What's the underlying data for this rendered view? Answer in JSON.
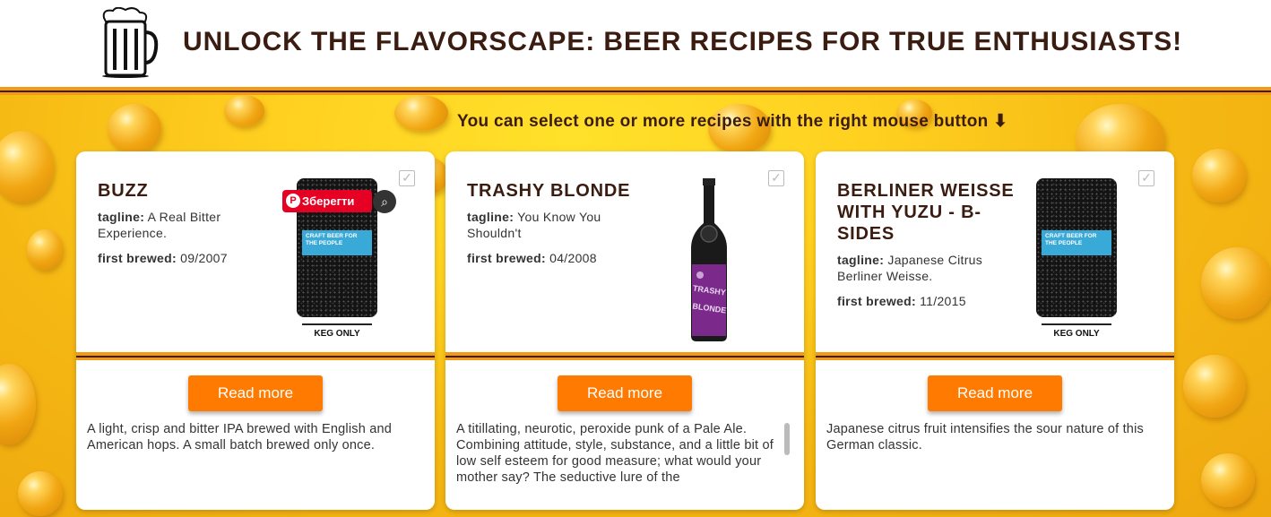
{
  "header": {
    "title": "UNLOCK THE FLAVORSCAPE: BEER RECIPES FOR TRUE ENTHUSIASTS!",
    "logo_icon": "beer-mug-icon"
  },
  "hint": "You can select one or more recipes with the right mouse button ⬇",
  "pinterest": {
    "label": "Зберегти",
    "icon": "pinterest-icon",
    "lens_icon": "visual-search-icon"
  },
  "labels": {
    "tagline": "tagline:",
    "first_brewed": "first brewed:"
  },
  "cards": [
    {
      "name": "BUZZ",
      "tagline": "A Real Bitter Experience.",
      "first_brewed": "09/2007",
      "image_type": "keg",
      "keg_label": "CRAFT BEER FOR THE PEOPLE",
      "keg_foot": "KEG ONLY",
      "button": "Read more",
      "description": "A light, crisp and bitter IPA brewed with English and American hops. A small batch brewed only once."
    },
    {
      "name": "TRASHY BLONDE",
      "tagline": "You Know You Shouldn't",
      "first_brewed": "04/2008",
      "image_type": "bottle",
      "bottle_label": "TRASHY BLONDE",
      "button": "Read more",
      "description": "A titillating, neurotic, peroxide punk of a Pale Ale. Combining attitude, style, substance, and a little bit of low self esteem for good measure; what would your mother say? The seductive lure of the"
    },
    {
      "name": "BERLINER WEISSE WITH YUZU - B-SIDES",
      "tagline": "Japanese Citrus Berliner Weisse.",
      "first_brewed": "11/2015",
      "image_type": "keg",
      "keg_label": "CRAFT BEER FOR THE PEOPLE",
      "keg_foot": "KEG ONLY",
      "button": "Read more",
      "description": "Japanese citrus fruit intensifies the sour nature of this German classic."
    }
  ],
  "colors": {
    "accent": "#ff7a00",
    "stripe": "#f39a12",
    "text_dark": "#3a1c10",
    "pinterest": "#e60023"
  }
}
